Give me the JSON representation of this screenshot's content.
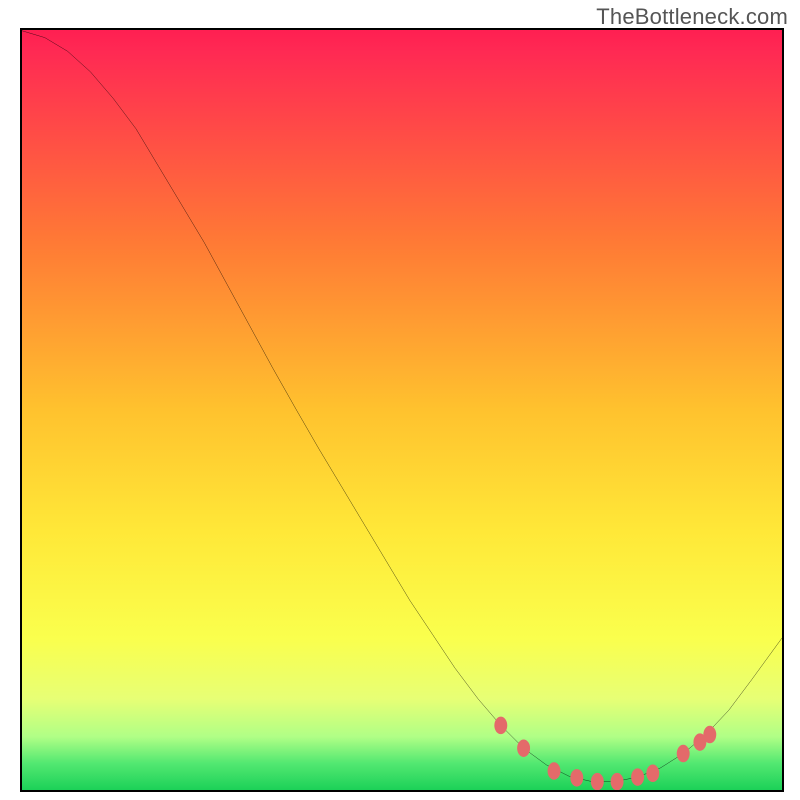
{
  "watermark": "TheBottleneck.com",
  "colors": {
    "gradient_top": "#ff1f52",
    "gradient_mid1": "#ff8a2a",
    "gradient_mid2": "#ffe838",
    "gradient_mid3": "#f6ff66",
    "gradient_bottom": "#1cde55",
    "border": "#000000",
    "curve": "#000000",
    "marker": "#e46a6a",
    "plot_bg_top": "#ff2a53",
    "plot_bg_bottom": "#20d45a"
  },
  "chart_data": {
    "type": "line",
    "title": "",
    "xlabel": "",
    "ylabel": "",
    "xlim": [
      0,
      100
    ],
    "ylim": [
      0,
      100
    ],
    "x": [
      0,
      3,
      6,
      9,
      12,
      15,
      18,
      21,
      24,
      27,
      30,
      33,
      36,
      39,
      42,
      45,
      48,
      51,
      54,
      57,
      60,
      63,
      66,
      69,
      72,
      75,
      78,
      81,
      84,
      87,
      90,
      93,
      96,
      100
    ],
    "values": [
      99.9,
      99,
      97.2,
      94.5,
      91,
      87,
      82,
      77,
      72,
      66.5,
      61,
      55.5,
      50.2,
      45,
      40,
      35,
      30,
      25,
      20.5,
      16,
      12,
      8.5,
      5.5,
      3.3,
      1.8,
      1.1,
      1.1,
      1.7,
      2.9,
      4.8,
      7.3,
      10.5,
      14.5,
      20
    ],
    "series": [
      {
        "name": "bottleneck-curve",
        "x": [
          0,
          3,
          6,
          9,
          12,
          15,
          18,
          21,
          24,
          27,
          30,
          33,
          36,
          39,
          42,
          45,
          48,
          51,
          54,
          57,
          60,
          63,
          66,
          69,
          72,
          75,
          78,
          81,
          84,
          87,
          90,
          93,
          96,
          100
        ],
        "y": [
          99.9,
          99,
          97.2,
          94.5,
          91,
          87,
          82,
          77,
          72,
          66.5,
          61,
          55.5,
          50.2,
          45,
          40,
          35,
          30,
          25,
          20.5,
          16,
          12,
          8.5,
          5.5,
          3.3,
          1.8,
          1.1,
          1.1,
          1.7,
          2.9,
          4.8,
          7.3,
          10.5,
          14.5,
          20
        ]
      }
    ],
    "markers": {
      "name": "highlighted-points",
      "x": [
        63,
        66,
        70,
        73,
        75.7,
        78.3,
        81,
        83,
        87,
        89.2,
        90.5
      ],
      "y": [
        8.5,
        5.5,
        2.5,
        1.6,
        1.1,
        1.1,
        1.7,
        2.2,
        4.8,
        6.3,
        7.3
      ]
    }
  }
}
